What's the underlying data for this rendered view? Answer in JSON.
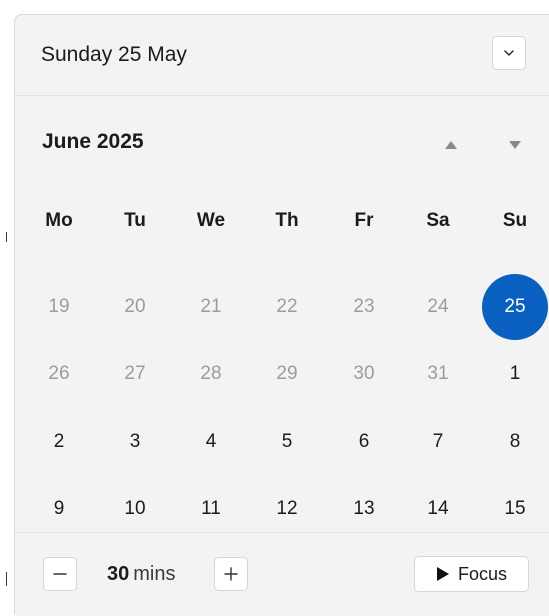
{
  "header": {
    "selected_date": "Sunday 25 May"
  },
  "calendar": {
    "month_title": "June 2025",
    "weekdays": [
      "Mo",
      "Tu",
      "We",
      "Th",
      "Fr",
      "Sa",
      "Su"
    ],
    "weeks": [
      [
        {
          "d": "19",
          "muted": true
        },
        {
          "d": "20",
          "muted": true
        },
        {
          "d": "21",
          "muted": true
        },
        {
          "d": "22",
          "muted": true
        },
        {
          "d": "23",
          "muted": true
        },
        {
          "d": "24",
          "muted": true
        },
        {
          "d": "25",
          "selected": true
        }
      ],
      [
        {
          "d": "26",
          "muted": true
        },
        {
          "d": "27",
          "muted": true
        },
        {
          "d": "28",
          "muted": true
        },
        {
          "d": "29",
          "muted": true
        },
        {
          "d": "30",
          "muted": true
        },
        {
          "d": "31",
          "muted": true
        },
        {
          "d": "1"
        }
      ],
      [
        {
          "d": "2"
        },
        {
          "d": "3"
        },
        {
          "d": "4"
        },
        {
          "d": "5"
        },
        {
          "d": "6"
        },
        {
          "d": "7"
        },
        {
          "d": "8"
        }
      ],
      [
        {
          "d": "9"
        },
        {
          "d": "10"
        },
        {
          "d": "11"
        },
        {
          "d": "12"
        },
        {
          "d": "13"
        },
        {
          "d": "14"
        },
        {
          "d": "15"
        }
      ]
    ],
    "selected_color": "#0a60c0",
    "muted_color": "#9c9c9c"
  },
  "footer": {
    "duration_value": "30",
    "duration_unit": "mins",
    "focus_label": "Focus"
  }
}
